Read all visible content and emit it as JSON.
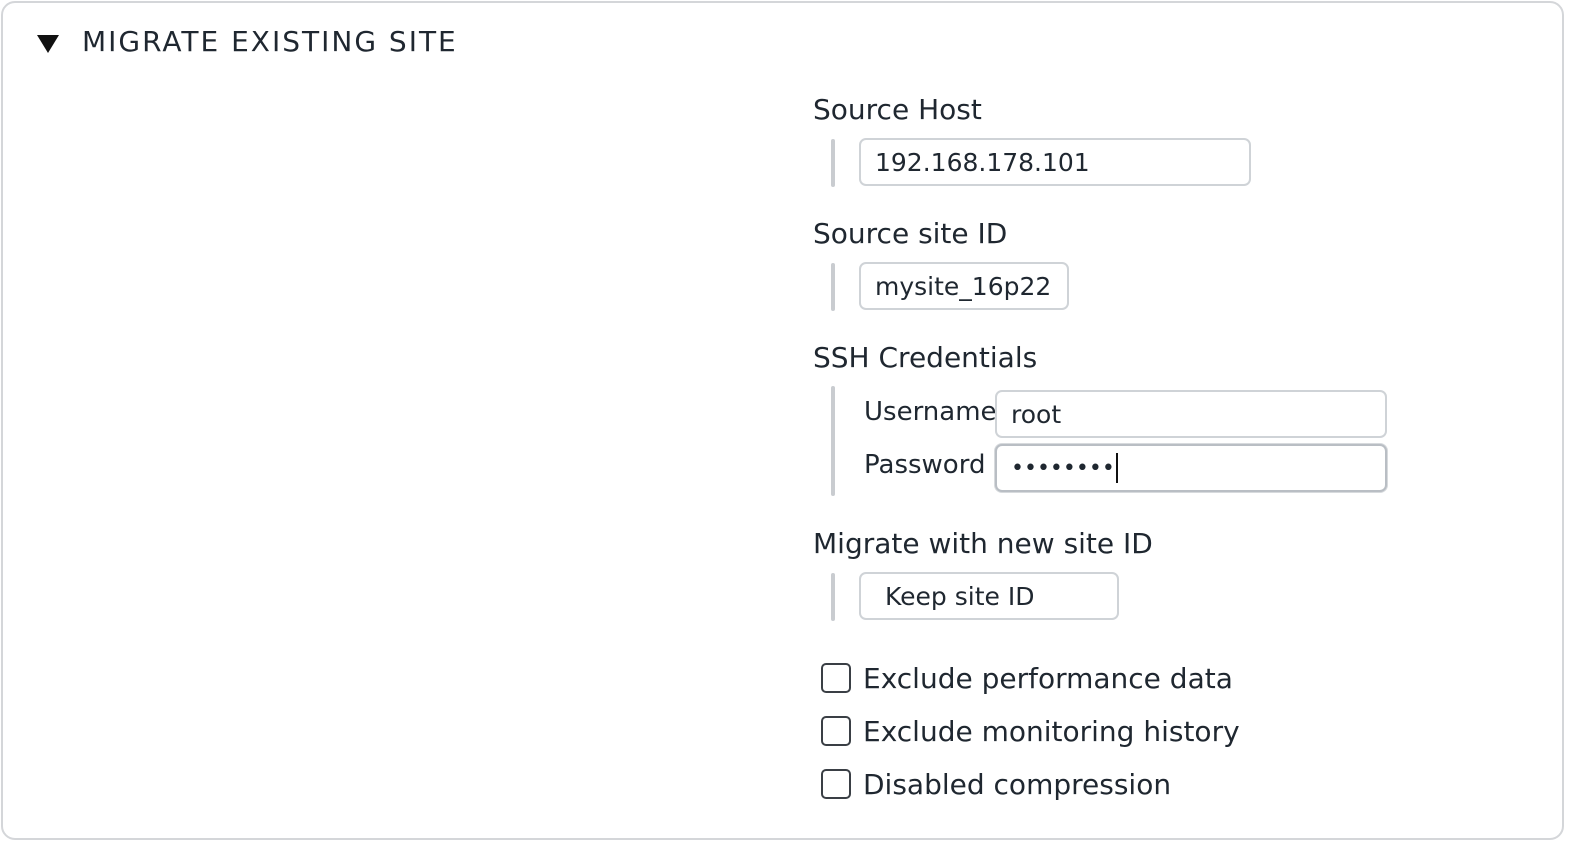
{
  "section": {
    "title": "MIGRATE EXISTING SITE"
  },
  "source_host": {
    "label": "Source Host",
    "value": "192.168.178.101"
  },
  "source_site_id": {
    "label": "Source site ID",
    "value": "mysite_16p22"
  },
  "ssh_credentials": {
    "label": "SSH Credentials",
    "username_label": "Username",
    "username_value": "root",
    "password_label": "Password",
    "password_masked": "••••••••"
  },
  "new_site_id": {
    "label": "Migrate with new site ID",
    "value": "Keep site ID"
  },
  "options": [
    {
      "label": "Exclude performance data",
      "checked": false
    },
    {
      "label": "Exclude monitoring history",
      "checked": false
    },
    {
      "label": "Disabled compression",
      "checked": false
    }
  ]
}
